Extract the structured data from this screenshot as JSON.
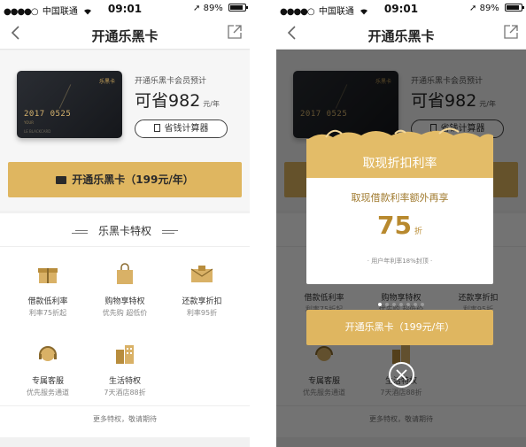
{
  "status_bar": {
    "carrier": "中国联通",
    "time": "09:01",
    "battery": "89%",
    "signal_dots": "●●●●○"
  },
  "nav": {
    "title": "开通乐黑卡"
  },
  "card": {
    "brand": "乐黑卡",
    "number": "2017 0525",
    "mini_text": "YOUR",
    "sub_text": "LE BLACKCARD"
  },
  "membership": {
    "estimate_label": "开通乐黑卡会员预计",
    "save_prefix": "可省",
    "save_amount": "982",
    "save_unit": "元/年",
    "calculator_label": "省钱计算器"
  },
  "open_button": {
    "label": "开通乐黑卡（199元/年）"
  },
  "privileges": {
    "title": "乐黑卡特权",
    "items": [
      {
        "icon": "gift-box-icon",
        "name": "借款低利率",
        "desc": "利率75折起"
      },
      {
        "icon": "shopping-bag-icon",
        "name": "购物享特权",
        "desc": "优先购 超低价"
      },
      {
        "icon": "envelope-discount-icon",
        "name": "还款享折扣",
        "desc": "利率95折"
      },
      {
        "icon": "customer-service-icon",
        "name": "专属客服",
        "desc": "优先服务通道"
      },
      {
        "icon": "hotel-building-icon",
        "name": "生活特权",
        "desc": "7天酒店88折"
      }
    ],
    "more_label": "更多特权，敬请期待"
  },
  "popup": {
    "title": "取现折扣利率",
    "subtitle": "取现借款利率额外再享",
    "value": "75",
    "value_unit": "折",
    "note": "· 用户年利率18%封顶 ·",
    "button_label": "开通乐黑卡（199元/年）",
    "page_count": 7,
    "active_page": 1
  },
  "colors": {
    "gold": "#dfb660",
    "gold_dark": "#b8892e",
    "banner": "#e3bc68",
    "card_dark": "#1c1e22"
  }
}
